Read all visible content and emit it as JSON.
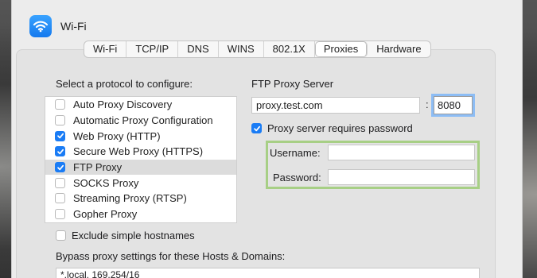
{
  "window": {
    "title": "Wi-Fi"
  },
  "tabs": [
    {
      "label": "Wi-Fi",
      "active": false
    },
    {
      "label": "TCP/IP",
      "active": false
    },
    {
      "label": "DNS",
      "active": false
    },
    {
      "label": "WINS",
      "active": false
    },
    {
      "label": "802.1X",
      "active": false
    },
    {
      "label": "Proxies",
      "active": true
    },
    {
      "label": "Hardware",
      "active": false
    }
  ],
  "protocols": {
    "heading": "Select a protocol to configure:",
    "items": [
      {
        "label": "Auto Proxy Discovery",
        "checked": false,
        "selected": false
      },
      {
        "label": "Automatic Proxy Configuration",
        "checked": false,
        "selected": false
      },
      {
        "label": "Web Proxy (HTTP)",
        "checked": true,
        "selected": false
      },
      {
        "label": "Secure Web Proxy (HTTPS)",
        "checked": true,
        "selected": false
      },
      {
        "label": "FTP Proxy",
        "checked": true,
        "selected": true
      },
      {
        "label": "SOCKS Proxy",
        "checked": false,
        "selected": false
      },
      {
        "label": "Streaming Proxy (RTSP)",
        "checked": false,
        "selected": false
      },
      {
        "label": "Gopher Proxy",
        "checked": false,
        "selected": false
      }
    ]
  },
  "exclude_simple_hostnames": {
    "label": "Exclude simple hostnames",
    "checked": false
  },
  "ftp_proxy": {
    "heading": "FTP Proxy Server",
    "server": "proxy.test.com",
    "colon": ":",
    "port": "8080",
    "requires_password": {
      "label": "Proxy server requires password",
      "checked": true
    },
    "username_label": "Username:",
    "username": "",
    "password_label": "Password:",
    "password": ""
  },
  "bypass": {
    "label": "Bypass proxy settings for these Hosts & Domains:",
    "value": "*.local, 169.254/16"
  },
  "colors": {
    "accent": "#1a7cf5",
    "highlight_border": "#a7cf85"
  },
  "icons": {
    "app": "wifi-icon",
    "check": "checkmark-icon"
  }
}
